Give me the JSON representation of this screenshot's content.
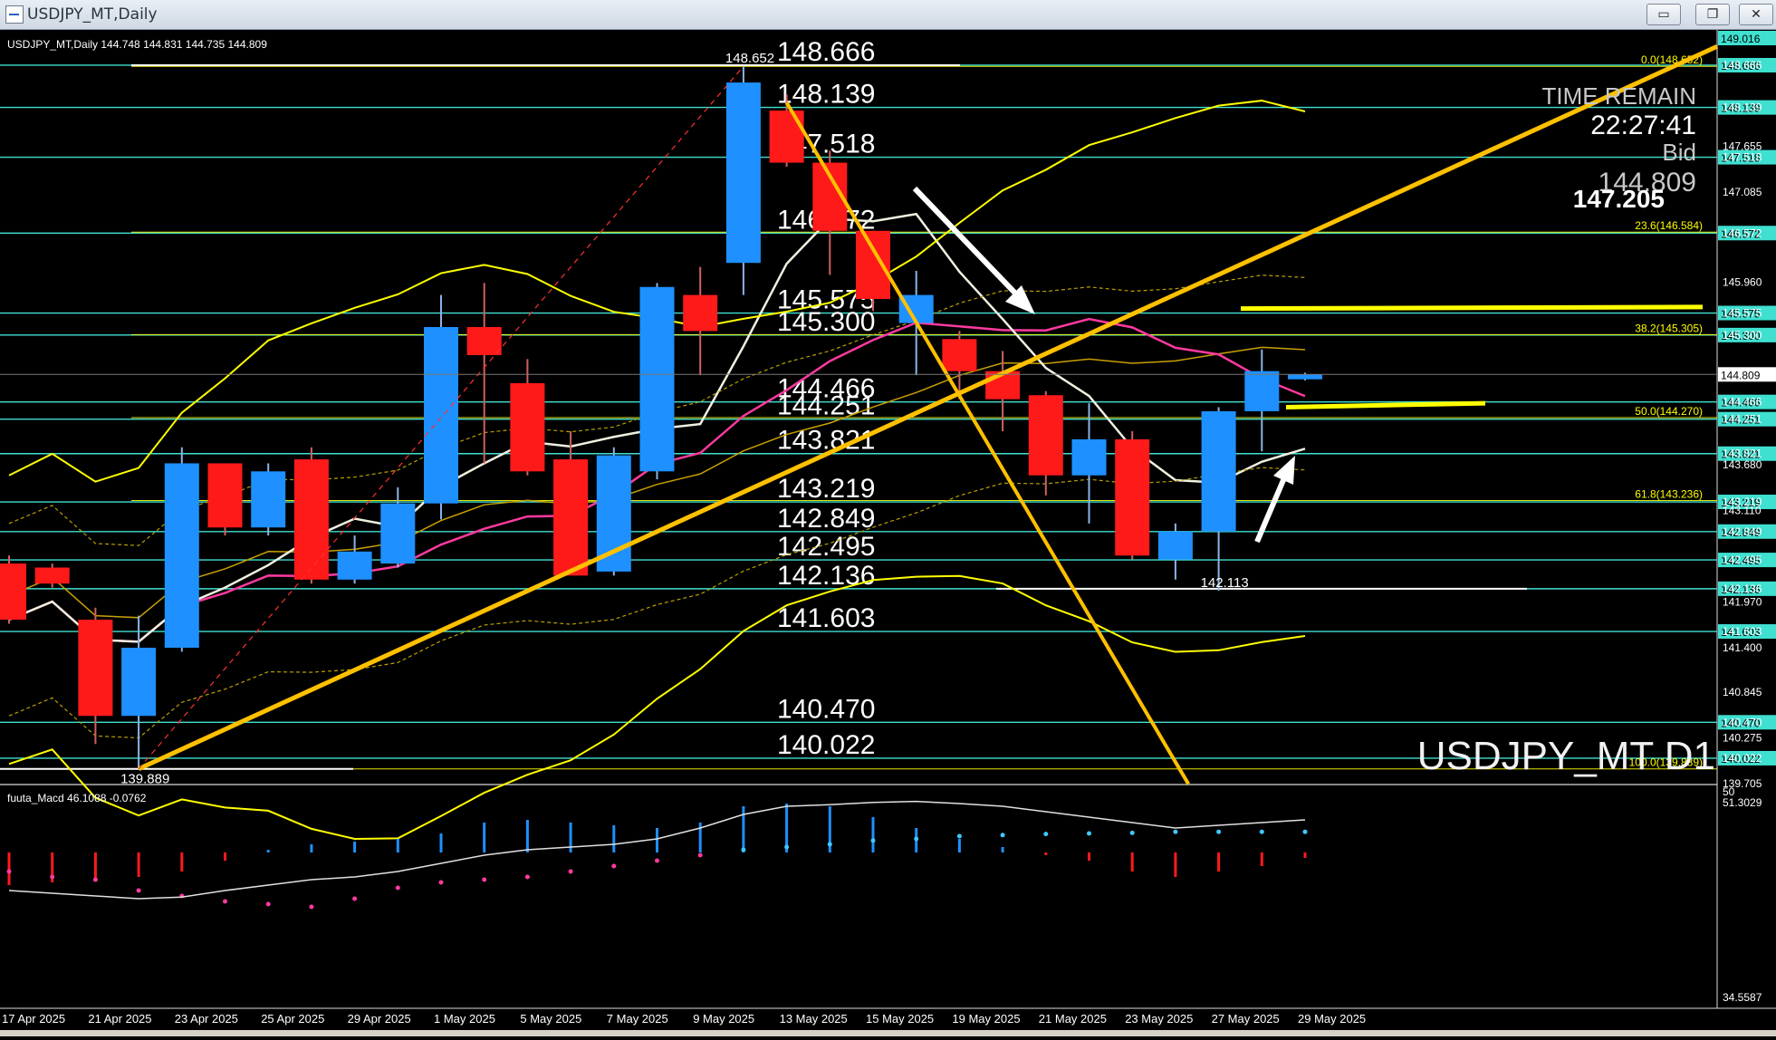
{
  "window": {
    "title": "USDJPY_MT,Daily",
    "buttons": [
      {
        "name": "minimize-button",
        "glyph": "▭"
      },
      {
        "name": "restore-button",
        "glyph": "❐"
      },
      {
        "name": "close-button",
        "glyph": "✕"
      }
    ]
  },
  "chart_data": {
    "type": "candlestick",
    "symbol_info": "USDJPY_MT,Daily  144.748 144.831 144.735 144.809",
    "watermark": "USDJPY_MT D1",
    "time_remain": {
      "label": "TIME REMAIN",
      "time": "22:27:41",
      "bid_label": "Bid",
      "bid": "144.809",
      "level": "147.205"
    },
    "ylim": [
      139.705,
      149.016
    ],
    "price_axis_ticks": [
      "149.016",
      "148.666",
      "148.139",
      "147.655",
      "147.518",
      "147.085",
      "146.572",
      "145.960",
      "145.575",
      "145.300",
      "144.809",
      "144.466",
      "144.251",
      "143.821",
      "143.680",
      "143.219",
      "143.110",
      "142.849",
      "142.495",
      "142.136",
      "141.970",
      "141.603",
      "141.400",
      "140.845",
      "140.470",
      "140.275",
      "140.022",
      "139.705"
    ],
    "x_labels": [
      "17 Apr 2025",
      "21 Apr 2025",
      "23 Apr 2025",
      "25 Apr 2025",
      "29 Apr 2025",
      "1 May 2025",
      "5 May 2025",
      "7 May 2025",
      "9 May 2025",
      "13 May 2025",
      "15 May 2025",
      "19 May 2025",
      "21 May 2025",
      "23 May 2025",
      "27 May 2025",
      "29 May 2025"
    ],
    "candles": [
      {
        "o": 142.45,
        "h": 142.55,
        "l": 141.7,
        "c": 141.75
      },
      {
        "o": 142.4,
        "h": 142.45,
        "l": 142.15,
        "c": 142.2
      },
      {
        "o": 141.75,
        "h": 141.9,
        "l": 140.2,
        "c": 140.55
      },
      {
        "o": 140.55,
        "h": 141.8,
        "l": 139.89,
        "c": 141.4
      },
      {
        "o": 141.4,
        "h": 143.9,
        "l": 141.35,
        "c": 143.7
      },
      {
        "o": 143.7,
        "h": 143.7,
        "l": 142.8,
        "c": 142.9
      },
      {
        "o": 142.9,
        "h": 143.7,
        "l": 142.8,
        "c": 143.6
      },
      {
        "o": 143.75,
        "h": 143.9,
        "l": 142.2,
        "c": 142.25
      },
      {
        "o": 142.25,
        "h": 142.8,
        "l": 142.2,
        "c": 142.6
      },
      {
        "o": 142.45,
        "h": 143.4,
        "l": 142.4,
        "c": 143.2
      },
      {
        "o": 143.2,
        "h": 145.8,
        "l": 143.0,
        "c": 145.4
      },
      {
        "o": 145.4,
        "h": 145.95,
        "l": 143.7,
        "c": 145.05
      },
      {
        "o": 144.7,
        "h": 145.0,
        "l": 143.55,
        "c": 143.6
      },
      {
        "o": 143.75,
        "h": 144.1,
        "l": 142.4,
        "c": 142.3
      },
      {
        "o": 142.35,
        "h": 143.9,
        "l": 142.3,
        "c": 143.8
      },
      {
        "o": 143.6,
        "h": 145.95,
        "l": 143.5,
        "c": 145.9
      },
      {
        "o": 145.8,
        "h": 146.15,
        "l": 144.8,
        "c": 145.35
      },
      {
        "o": 146.2,
        "h": 148.65,
        "l": 145.8,
        "c": 148.45
      },
      {
        "o": 148.1,
        "h": 148.3,
        "l": 147.4,
        "c": 147.45
      },
      {
        "o": 147.45,
        "h": 147.6,
        "l": 146.05,
        "c": 146.6
      },
      {
        "o": 146.6,
        "h": 146.6,
        "l": 145.6,
        "c": 145.75
      },
      {
        "o": 145.45,
        "h": 146.1,
        "l": 144.8,
        "c": 145.8
      },
      {
        "o": 145.25,
        "h": 145.35,
        "l": 144.5,
        "c": 144.85
      },
      {
        "o": 144.85,
        "h": 145.1,
        "l": 144.1,
        "c": 144.5
      },
      {
        "o": 144.55,
        "h": 144.6,
        "l": 143.3,
        "c": 143.55
      },
      {
        "o": 143.55,
        "h": 144.45,
        "l": 142.95,
        "c": 144.0
      },
      {
        "o": 144.0,
        "h": 144.1,
        "l": 142.5,
        "c": 142.55
      },
      {
        "o": 142.5,
        "h": 142.95,
        "l": 142.25,
        "c": 142.85
      },
      {
        "o": 142.85,
        "h": 144.4,
        "l": 142.11,
        "c": 144.35
      },
      {
        "o": 144.35,
        "h": 145.12,
        "l": 143.85,
        "c": 144.85
      },
      {
        "o": 144.748,
        "h": 144.831,
        "l": 144.735,
        "c": 144.809
      }
    ],
    "horizontal_levels": [
      {
        "price": 148.666,
        "label": "148.666",
        "tag": "148.666"
      },
      {
        "price": 148.139,
        "label": "148.139",
        "tag": "148.139"
      },
      {
        "price": 147.518,
        "label": "147.518",
        "tag": "147.518"
      },
      {
        "price": 146.572,
        "label": "146.572",
        "tag": "146.572"
      },
      {
        "price": 145.575,
        "label": "145.575",
        "tag": "145.575"
      },
      {
        "price": 145.3,
        "label": "145.300",
        "tag": "145.300"
      },
      {
        "price": 144.466,
        "label": "144.466",
        "tag": "144.466"
      },
      {
        "price": 144.251,
        "label": "144.251",
        "tag": "144.251"
      },
      {
        "price": 143.821,
        "label": "143.821",
        "tag": "143.821"
      },
      {
        "price": 143.219,
        "label": "143.219",
        "tag": "143.219"
      },
      {
        "price": 142.849,
        "label": "142.849",
        "tag": "142.849"
      },
      {
        "price": 142.495,
        "label": "142.495",
        "tag": "142.495"
      },
      {
        "price": 142.136,
        "label": "142.136",
        "tag": "142.136"
      },
      {
        "price": 141.603,
        "label": "141.603",
        "tag": "141.603"
      },
      {
        "price": 140.47,
        "label": "140.470",
        "tag": "140.470"
      },
      {
        "price": 140.022,
        "label": "140.022",
        "tag": "140.022"
      }
    ],
    "fibo_levels": [
      {
        "price": 148.652,
        "label": "0.0(148.652)"
      },
      {
        "price": 146.584,
        "label": "23.6(146.584)"
      },
      {
        "price": 145.305,
        "label": "38.2(145.305)"
      },
      {
        "price": 144.27,
        "label": "50.0(144.270)"
      },
      {
        "price": 143.236,
        "label": "61.8(143.236)"
      },
      {
        "price": 139.889,
        "label": "100.0(139.889)"
      }
    ],
    "extreme_labels": [
      {
        "text": "148.652",
        "price": 148.652,
        "bar": 17
      },
      {
        "text": "142.113",
        "price": 142.113,
        "bar": 28
      },
      {
        "text": "139.889",
        "price": 139.889,
        "bar": 3
      }
    ],
    "price_tag_current": "144.809",
    "macd": {
      "label": "fuuta_Macd 46.1088 -0.0762",
      "ymax": "50",
      "ymax_value": "51.3029",
      "ymin_value": "34.5587",
      "bars": [
        -0.6,
        -0.55,
        -0.5,
        -0.45,
        -0.35,
        -0.15,
        0.05,
        0.15,
        0.2,
        0.25,
        0.35,
        0.55,
        0.6,
        0.55,
        0.5,
        0.45,
        0.55,
        0.85,
        0.9,
        0.85,
        0.65,
        0.45,
        0.25,
        0.1,
        -0.05,
        -0.15,
        -0.35,
        -0.45,
        -0.35,
        -0.25,
        -0.1
      ],
      "signal_dots": [
        -0.35,
        -0.45,
        -0.5,
        -0.7,
        -0.8,
        -0.9,
        -0.95,
        -1.0,
        -0.85,
        -0.65,
        -0.55,
        -0.5,
        -0.45,
        -0.35,
        -0.25,
        -0.15,
        -0.05,
        0.05,
        0.1,
        0.15,
        0.22,
        0.25,
        0.3,
        0.32,
        0.34,
        0.35,
        0.36,
        0.38,
        0.38,
        0.38,
        0.38
      ],
      "line": [
        -0.7,
        -0.75,
        -0.8,
        -0.85,
        -0.82,
        -0.7,
        -0.6,
        -0.5,
        -0.45,
        -0.35,
        -0.2,
        -0.05,
        0.05,
        0.1,
        0.15,
        0.25,
        0.45,
        0.7,
        0.85,
        0.88,
        0.92,
        0.94,
        0.9,
        0.85,
        0.75,
        0.65,
        0.55,
        0.45,
        0.5,
        0.55,
        0.6
      ]
    }
  },
  "colors": {
    "bull": "#1e90ff",
    "bear": "#ff1a1a",
    "level": "#40e0d0",
    "fib": "#ffff00",
    "trend": "#ffc000",
    "band": "#ffff00",
    "ma_pink": "#ff3aa0",
    "ma_white": "#f0f0e0",
    "ma_gold": "#c8a000",
    "fan": "#ff3030",
    "axis": "#ffffff"
  }
}
